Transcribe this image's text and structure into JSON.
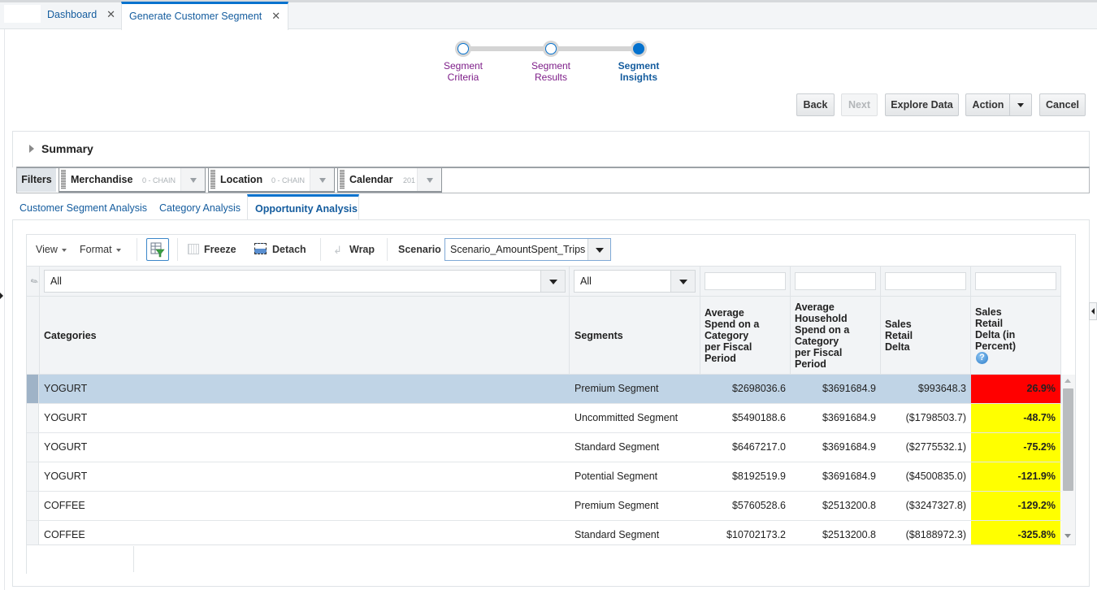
{
  "tabs": [
    {
      "label": "Dashboard",
      "close": "✕",
      "active": false
    },
    {
      "label": "Generate Customer Segment",
      "close": "✕",
      "active": true
    }
  ],
  "train": {
    "stops": [
      {
        "line1": "Segment",
        "line2": "Criteria",
        "state": "visited"
      },
      {
        "line1": "Segment",
        "line2": "Results",
        "state": "visited"
      },
      {
        "line1": "Segment",
        "line2": "Insights",
        "state": "current"
      }
    ]
  },
  "buttons": {
    "back": "Back",
    "next": "Next",
    "explore": "Explore Data",
    "action": "Action",
    "cancel": "Cancel"
  },
  "summary": {
    "title": "Summary"
  },
  "filters": {
    "label": "Filters",
    "items": [
      {
        "name": "Merchandise",
        "value": "0 - CHAIN"
      },
      {
        "name": "Location",
        "value": "0 - CHAIN"
      },
      {
        "name": "Calendar",
        "value": "201"
      }
    ]
  },
  "subtabs": [
    {
      "label": "Customer Segment Analysis",
      "active": false
    },
    {
      "label": "Category Analysis",
      "active": false
    },
    {
      "label": "Opportunity Analysis",
      "active": true
    }
  ],
  "toolbar": {
    "view": "View",
    "format": "Format",
    "freeze": "Freeze",
    "detach": "Detach",
    "wrap": "Wrap",
    "scenario_label": "Scenario",
    "scenario_value": "Scenario_AmountSpent_Trips"
  },
  "table": {
    "filters": {
      "categories": "All",
      "segments": "All"
    },
    "columns": {
      "categories": "Categories",
      "segments": "Segments",
      "avg_spend": [
        "Average",
        "Spend on a",
        "Category",
        "per Fiscal",
        "Period"
      ],
      "avg_household": [
        "Average",
        "Household",
        "Spend on a",
        "Category",
        "per Fiscal",
        "Period"
      ],
      "delta": [
        "Sales",
        "Retail",
        "Delta"
      ],
      "delta_pct": [
        "Sales",
        "Retail",
        "Delta (in",
        "Percent)"
      ]
    },
    "help_icon": "?",
    "rows": [
      {
        "category": "YOGURT",
        "segment": "Premium Segment",
        "avg_spend": "$2698036.6",
        "avg_household": "$3691684.9",
        "delta": "$993648.3",
        "delta_pct": "26.9%",
        "pct_color": "#ff0000",
        "selected": true
      },
      {
        "category": "YOGURT",
        "segment": "Uncommitted Segment",
        "avg_spend": "$5490188.6",
        "avg_household": "$3691684.9",
        "delta": "($1798503.7)",
        "delta_pct": "-48.7%",
        "pct_color": "#ffff00",
        "selected": false
      },
      {
        "category": "YOGURT",
        "segment": "Standard Segment",
        "avg_spend": "$6467217.0",
        "avg_household": "$3691684.9",
        "delta": "($2775532.1)",
        "delta_pct": "-75.2%",
        "pct_color": "#ffff00",
        "selected": false
      },
      {
        "category": "YOGURT",
        "segment": "Potential Segment",
        "avg_spend": "$8192519.9",
        "avg_household": "$3691684.9",
        "delta": "($4500835.0)",
        "delta_pct": "-121.9%",
        "pct_color": "#ffff00",
        "selected": false
      },
      {
        "category": "COFFEE",
        "segment": "Premium Segment",
        "avg_spend": "$5760528.6",
        "avg_household": "$2513200.8",
        "delta": "($3247327.8)",
        "delta_pct": "-129.2%",
        "pct_color": "#ffff00",
        "selected": false
      },
      {
        "category": "COFFEE",
        "segment": "Standard Segment",
        "avg_spend": "$10702173.2",
        "avg_household": "$2513200.8",
        "delta": "($8188972.3)",
        "delta_pct": "-325.8%",
        "pct_color": "#ffff00",
        "selected": false
      }
    ]
  }
}
